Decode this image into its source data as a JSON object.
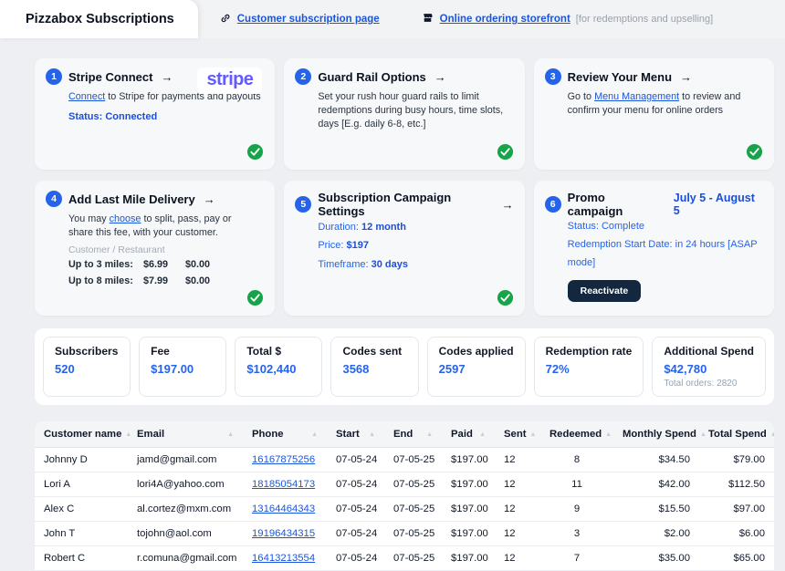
{
  "colors": {
    "accent_blue": "#2563eb",
    "link_blue": "#1a56db",
    "success_green": "#17a348",
    "navy_button": "#13273f",
    "stripe_purple": "#635bff"
  },
  "icons": {
    "arrow": "→",
    "sort_asc": "▲",
    "link_icon": "chain-link",
    "storefront_icon": "storefront",
    "check_icon": "checkmark-circle"
  },
  "header": {
    "title": "Pizzabox Subscriptions",
    "links": [
      {
        "label": "Customer subscription page"
      },
      {
        "label": "Online ordering storefront",
        "note": "[for redemptions and upselling]"
      }
    ]
  },
  "cards": {
    "stripe_connect": {
      "number": "1",
      "title": "Stripe Connect",
      "logo": "stripe",
      "body_link": "Connect",
      "body_rest": " to Stripe for payments and payouts",
      "status": "Status: Connected"
    },
    "guard_rail": {
      "number": "2",
      "title": "Guard Rail Options",
      "body": "Set your rush hour guard rails to limit redemptions during busy hours, time slots, days [E.g. daily 6-8, etc.]"
    },
    "review_menu": {
      "number": "3",
      "title": "Review Your Menu",
      "body_pre": "Go to ",
      "body_link": "Menu Management",
      "body_rest": " to review and confirm your menu for online orders"
    },
    "last_mile": {
      "number": "4",
      "title": "Add Last Mile Delivery",
      "body_pre": "You may ",
      "body_link": "choose",
      "body_rest": " to split, pass, pay or share this fee, with your customer.",
      "fee_header": "Customer / Restaurant",
      "fees": [
        {
          "label": "Up to 3 miles:",
          "customer": "$6.99",
          "restaurant": "$0.00"
        },
        {
          "label": "Up to 8 miles:",
          "customer": "$7.99",
          "restaurant": "$0.00"
        }
      ]
    },
    "campaign_settings": {
      "number": "5",
      "title": "Subscription Campaign Settings",
      "settings": [
        {
          "label": "Duration: ",
          "value": "12 month"
        },
        {
          "label": "Price: ",
          "value": "$197"
        },
        {
          "label": "Timeframe: ",
          "value": "30 days"
        }
      ]
    },
    "promo": {
      "number": "6",
      "title": "Promo campaign",
      "date_range": "July 5 - August 5",
      "status": "Status: Complete",
      "redemption": "Redemption Start Date: in 24 hours [ASAP mode]",
      "button": "Reactivate"
    }
  },
  "stats": [
    {
      "label": "Subscribers",
      "value": "520"
    },
    {
      "label": "Fee",
      "value": "$197.00"
    },
    {
      "label": "Total $",
      "value": "$102,440"
    },
    {
      "label": "Codes sent",
      "value": "3568"
    },
    {
      "label": "Codes applied",
      "value": "2597"
    },
    {
      "label": "Redemption rate",
      "value": "72%"
    },
    {
      "label": "Additional Spend",
      "value": "$42,780",
      "sub": "Total orders: 2820"
    }
  ],
  "table": {
    "headers": [
      "Customer name",
      "Email",
      "Phone",
      "Start",
      "End",
      "Paid",
      "Sent",
      "Redeemed",
      "Monthly Spend",
      "Total Spend"
    ],
    "rows": [
      [
        "Johnny D",
        "jamd@gmail.com",
        "16167875256",
        "07-05-24",
        "07-05-25",
        "$197.00",
        "12",
        "8",
        "$34.50",
        "$79.00"
      ],
      [
        "Lori A",
        "lori4A@yahoo.com",
        "18185054173",
        "07-05-24",
        "07-05-25",
        "$197.00",
        "12",
        "11",
        "$42.00",
        "$112.50"
      ],
      [
        "Alex C",
        "al.cortez@mxm.com",
        "13164464343",
        "07-05-24",
        "07-05-25",
        "$197.00",
        "12",
        "9",
        "$15.50",
        "$97.00"
      ],
      [
        "John T",
        "tojohn@aol.com",
        "19196434315",
        "07-05-24",
        "07-05-25",
        "$197.00",
        "12",
        "3",
        "$2.00",
        "$6.00"
      ],
      [
        "Robert C",
        "r.comuna@gmail.com",
        "16413213554",
        "07-05-24",
        "07-05-25",
        "$197.00",
        "12",
        "7",
        "$35.00",
        "$65.00"
      ]
    ]
  }
}
